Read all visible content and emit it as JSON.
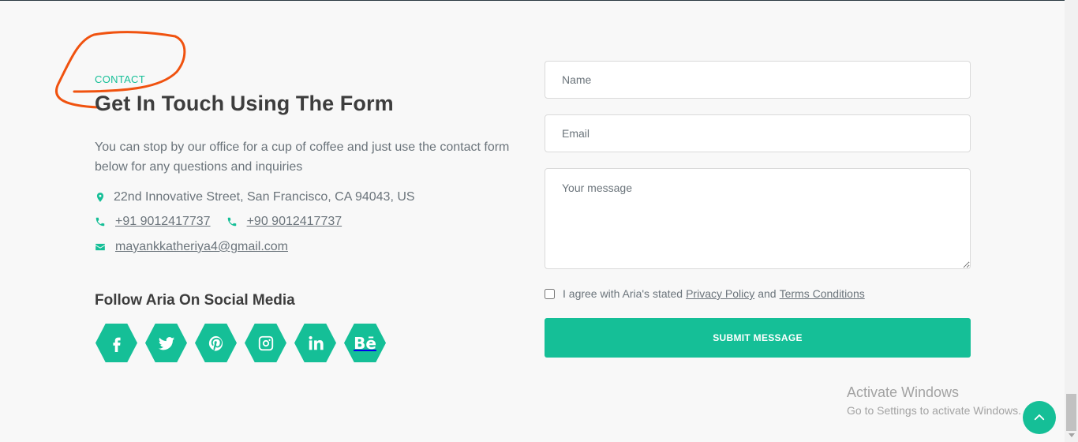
{
  "contact": {
    "eyebrow": "CONTACT",
    "heading": "Get In Touch Using The Form",
    "lead": "You can stop by our office for a cup of coffee and just use the contact form below for any questions and inquiries",
    "address": "22nd Innovative Street, San Francisco, CA 94043, US",
    "phone1": "+91 9012417737",
    "phone2": "+90 9012417737",
    "email": "mayankkatheriya4@gmail.com"
  },
  "social": {
    "title": "Follow Aria On Social Media",
    "items": [
      "facebook-icon",
      "twitter-icon",
      "pinterest-icon",
      "instagram-icon",
      "linkedin-icon",
      "behance-icon"
    ],
    "behance_label": "Bē"
  },
  "form": {
    "name_placeholder": "Name",
    "email_placeholder": "Email",
    "message_placeholder": "Your message",
    "agree_prefix": "I agree with Aria's stated",
    "privacy_label": "Privacy Policy",
    "and_label": "and",
    "terms_label": "Terms Conditions",
    "submit_label": "SUBMIT MESSAGE"
  },
  "os_watermark": {
    "title": "Activate Windows",
    "subtitle": "Go to Settings to activate Windows."
  },
  "colors": {
    "accent": "#15bf97",
    "heading": "#3d3d3d",
    "body_text": "#6b747b",
    "annotation": "#f0520f"
  }
}
